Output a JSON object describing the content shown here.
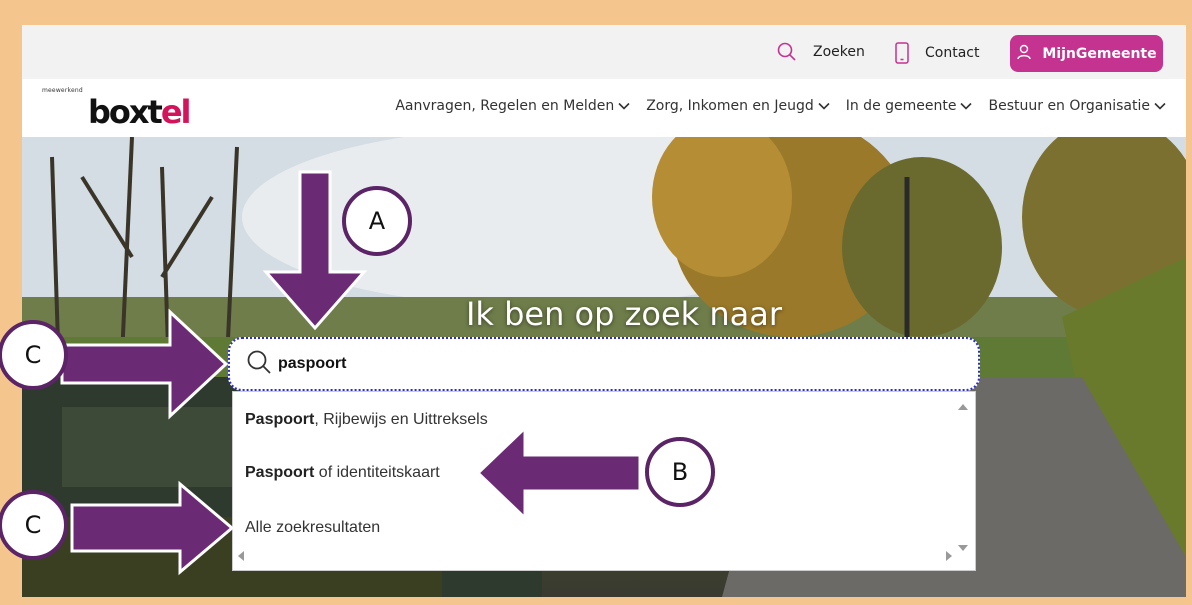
{
  "utility": {
    "search_label": "Zoeken",
    "contact_label": "Contact",
    "account_label": "MijnGemeente",
    "account_color": "#c4338f"
  },
  "logo": {
    "tagline": "meewerkend",
    "name_main": "boxt",
    "name_accent": "el",
    "accent_color": "#d4145a"
  },
  "nav": {
    "items": [
      {
        "label": "Aanvragen, Regelen en Melden"
      },
      {
        "label": "Zorg, Inkomen en Jeugd"
      },
      {
        "label": "In de gemeente"
      },
      {
        "label": "Bestuur en Organisatie"
      }
    ]
  },
  "hero": {
    "title": "Ik ben op zoek naar"
  },
  "search": {
    "value": "paspoort",
    "suggestions": [
      {
        "bold": "Paspoort",
        "rest": ", Rijbewijs en Uittreksels"
      },
      {
        "bold": "Paspoort",
        "rest": " of identiteitskaart"
      },
      {
        "bold": "",
        "rest": "Alle zoekresultaten"
      }
    ]
  },
  "annotations": {
    "a": "A",
    "b": "B",
    "c1": "C",
    "c2": "C",
    "arrow_color": "#6b2a74"
  }
}
